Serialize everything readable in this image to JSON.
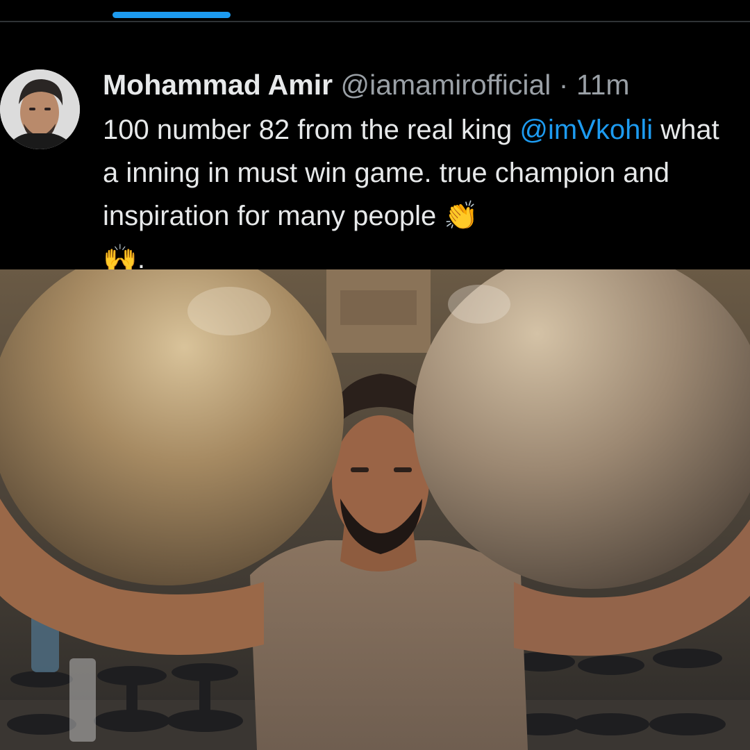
{
  "tweet": {
    "author_name": "Mohammad Amir",
    "handle": "@iamamirofficial",
    "separator": "·",
    "time": "11m",
    "text_part1": "100 number 82 from the real king ",
    "mention": "@imVkohli",
    "text_part2": " what a inning in must win game. true champion and inspiration for many people ",
    "emoji_clap": "👏",
    "emoji_raised_hands": "🙌",
    "text_end": "."
  },
  "colors": {
    "background": "#000000",
    "accent": "#1d9bf0",
    "text_primary": "#e7e9ea",
    "text_secondary": "#9aa0a6"
  },
  "icons": [
    "avatar-photo",
    "clapping-hands-emoji",
    "raised-hands-emoji"
  ]
}
